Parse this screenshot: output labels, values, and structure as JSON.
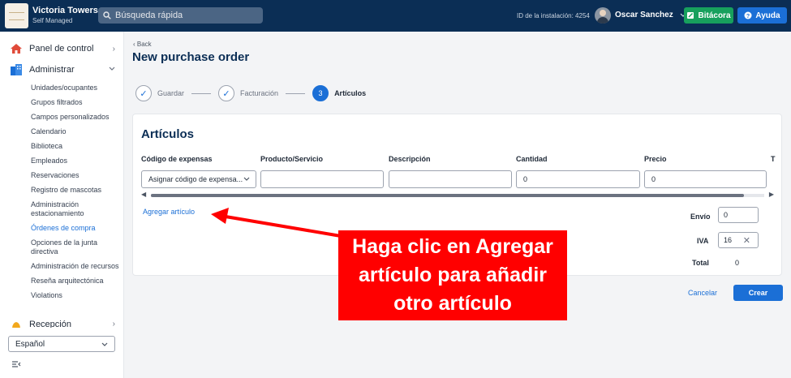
{
  "app": {
    "name": "Victoria Towers",
    "subtitle": "Self Managed"
  },
  "topbar": {
    "search_placeholder": "Búsqueda rápida",
    "install_id": "ID de la instalación: 4254",
    "user_name": "Oscar Sanchez",
    "bitacora_label": "Bitácora",
    "help_label": "Ayuda"
  },
  "sidebar": {
    "panel_label": "Panel de control",
    "admin_label": "Administrar",
    "items": [
      "Unidades/ocupantes",
      "Grupos filtrados",
      "Campos personalizados",
      "Calendario",
      "Biblioteca",
      "Empleados",
      "Reservaciones",
      "Registro de mascotas",
      "Administración estacionamiento",
      "Órdenes de compra",
      "Opciones de la junta directiva",
      "Administración de recursos",
      "Reseña arquitectónica",
      "Violations"
    ],
    "active_item": "Órdenes de compra",
    "reception_label": "Recepción",
    "language": "Español"
  },
  "page": {
    "back_label": "Back",
    "title": "New purchase order",
    "steps": [
      {
        "label": "Guardar",
        "state": "done",
        "marker": "✓"
      },
      {
        "label": "Facturación",
        "state": "done",
        "marker": "✓"
      },
      {
        "label": "Artículos",
        "state": "current",
        "marker": "3"
      }
    ]
  },
  "articles": {
    "title": "Artículos",
    "columns": [
      "Código de expensas",
      "Producto/Servicio",
      "Descripción",
      "Cantidad",
      "Precio",
      "T"
    ],
    "row": {
      "expense_code": "Asignar código de expensa...",
      "product": "",
      "description": "",
      "quantity": "0",
      "price": "0"
    },
    "add_link": "Agregar artículo",
    "shipping_label": "Envío",
    "shipping_value": "0",
    "iva_label": "IVA",
    "iva_value": "16",
    "total_label": "Total",
    "total_value": "0"
  },
  "actions": {
    "cancel": "Cancelar",
    "create": "Crear"
  },
  "callout": {
    "text": "Haga clic en Agregar artículo para añadir otro artículo"
  },
  "colors": {
    "navy": "#0b2e55",
    "accent": "#1b6fd6",
    "green": "#17a05d",
    "callout": "#ff0000"
  }
}
